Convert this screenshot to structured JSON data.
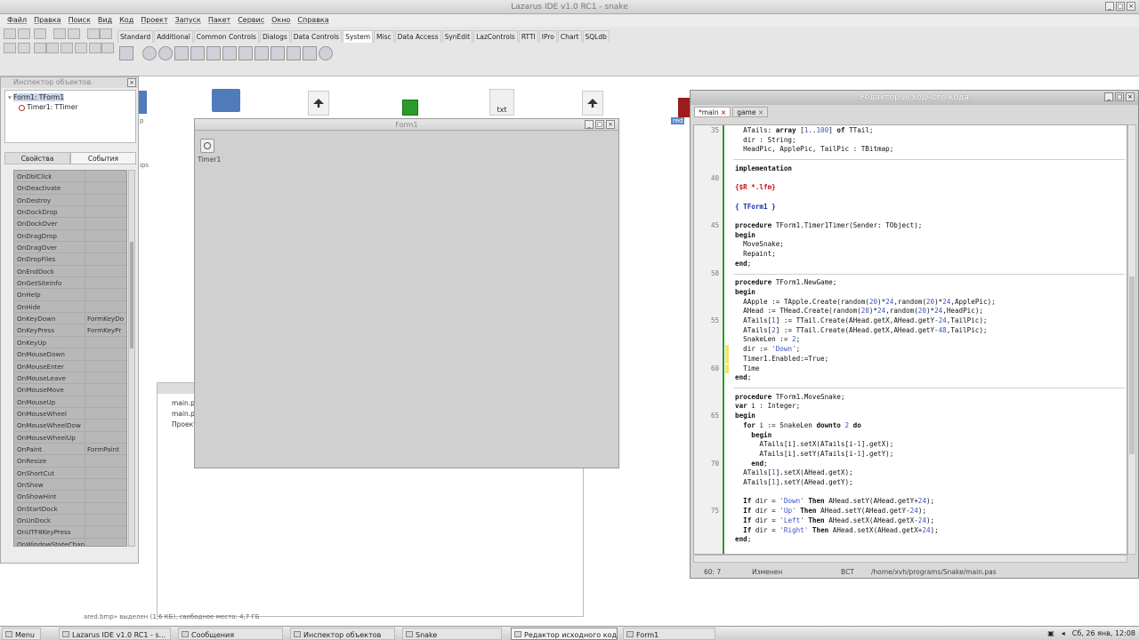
{
  "ide": {
    "title": "Lazarus IDE v1.0 RC1 - snake",
    "menu": [
      "Файл",
      "Правка",
      "Поиск",
      "Вид",
      "Код",
      "Проект",
      "Запуск",
      "Пакет",
      "Сервис",
      "Окно",
      "Справка"
    ],
    "palette_tabs": [
      "Standard",
      "Additional",
      "Common Controls",
      "Dialogs",
      "Data Controls",
      "System",
      "Misc",
      "Data Access",
      "SynEdit",
      "LazControls",
      "RTTI",
      "IPro",
      "Chart",
      "SQLdb"
    ],
    "active_palette_tab": "System"
  },
  "desktop_icons": {
    "txt_label": "txt",
    "side_label_1": "p",
    "side_label_2": "ips",
    "red_label": "red"
  },
  "inspector": {
    "title": "Инспектор объектов",
    "tree": [
      {
        "label": "Form1: TForm1"
      },
      {
        "label": "Timer1: TTimer"
      }
    ],
    "tabs": [
      "Свойства",
      "События"
    ],
    "active_tab": "События",
    "events": [
      {
        "name": "OnDblClick",
        "value": ""
      },
      {
        "name": "OnDeactivate",
        "value": ""
      },
      {
        "name": "OnDestroy",
        "value": ""
      },
      {
        "name": "OnDockDrop",
        "value": ""
      },
      {
        "name": "OnDockOver",
        "value": ""
      },
      {
        "name": "OnDragDrop",
        "value": ""
      },
      {
        "name": "OnDragOver",
        "value": ""
      },
      {
        "name": "OnDropFiles",
        "value": ""
      },
      {
        "name": "OnEndDock",
        "value": ""
      },
      {
        "name": "OnGetSiteInfo",
        "value": ""
      },
      {
        "name": "OnHelp",
        "value": ""
      },
      {
        "name": "OnHide",
        "value": ""
      },
      {
        "name": "OnKeyDown",
        "value": "FormKeyDo"
      },
      {
        "name": "OnKeyPress",
        "value": "FormKeyPr"
      },
      {
        "name": "OnKeyUp",
        "value": ""
      },
      {
        "name": "OnMouseDown",
        "value": ""
      },
      {
        "name": "OnMouseEnter",
        "value": ""
      },
      {
        "name": "OnMouseLeave",
        "value": ""
      },
      {
        "name": "OnMouseMove",
        "value": ""
      },
      {
        "name": "OnMouseUp",
        "value": ""
      },
      {
        "name": "OnMouseWheel",
        "value": ""
      },
      {
        "name": "OnMouseWheelDow",
        "value": ""
      },
      {
        "name": "OnMouseWheelUp",
        "value": ""
      },
      {
        "name": "OnPaint",
        "value": "FormPaint"
      },
      {
        "name": "OnResize",
        "value": ""
      },
      {
        "name": "OnShortCut",
        "value": ""
      },
      {
        "name": "OnShow",
        "value": ""
      },
      {
        "name": "OnShowHint",
        "value": ""
      },
      {
        "name": "OnStartDock",
        "value": ""
      },
      {
        "name": "OnUnDock",
        "value": ""
      },
      {
        "name": "OnUTF8KeyPress",
        "value": ""
      },
      {
        "name": "OnWindowStateChan",
        "value": ""
      }
    ]
  },
  "messages": {
    "lines": [
      "main.p",
      "main.p",
      "Проект"
    ]
  },
  "form1": {
    "title": "Form1",
    "timer_label": "Timer1"
  },
  "editor": {
    "title": "Редактор исходного кода",
    "tabs": [
      "*main",
      "game"
    ],
    "active_tab": "*main",
    "line_numbers": [
      {
        "n": "35",
        "row": 0
      },
      {
        "n": "40",
        "row": 5
      },
      {
        "n": "45",
        "row": 10
      },
      {
        "n": "50",
        "row": 15
      },
      {
        "n": "55",
        "row": 20
      },
      {
        "n": "60",
        "row": 25
      },
      {
        "n": "65",
        "row": 30
      },
      {
        "n": "70",
        "row": 35
      },
      {
        "n": "75",
        "row": 40
      }
    ],
    "code_lines": [
      "  ATails: array [1..100] of TTail;",
      "  dir : String;",
      "  HeadPic, ApplePic, TailPic : TBitmap;",
      "",
      "implementation",
      "",
      "{$R *.lfm}",
      "",
      "{ TForm1 }",
      "",
      "procedure TForm1.Timer1Timer(Sender: TObject);",
      "begin",
      "  MoveSnake;",
      "  Repaint;",
      "end;",
      "",
      "procedure TForm1.NewGame;",
      "begin",
      "  AApple := TApple.Create(random(20)*24,random(20)*24,ApplePic);",
      "  AHead := THead.Create(random(20)*24,random(20)*24,HeadPic);",
      "  ATails[1] := TTail.Create(AHead.getX,AHead.getY-24,TailPic);",
      "  ATails[2] := TTail.Create(AHead.getX,AHead.getY-48,TailPic);",
      "  SnakeLen := 2;",
      "  dir := 'Down';",
      "  Timer1.Enabled:=True;",
      "  Time",
      "end;",
      "",
      "procedure TForm1.MoveSnake;",
      "var i : Integer;",
      "begin",
      "  for i := SnakeLen downto 2 do",
      "    begin",
      "      ATails[i].setX(ATails[i-1].getX);",
      "      ATails[i].setY(ATails[i-1].getY);",
      "    end;",
      "  ATails[1].setX(AHead.getX);",
      "  ATails[1].setY(AHead.getY);",
      "",
      "  If dir = 'Down' Then AHead.setY(AHead.getY+24);",
      "  If dir = 'Up' Then AHead.setY(AHead.getY-24);",
      "  If dir = 'Left' Then AHead.setX(AHead.getX-24);",
      "  If dir = 'Right' Then AHead.setX(AHead.getX+24);",
      "end;"
    ],
    "status": {
      "position": "60: 7",
      "modified": "Изменен",
      "mode": "ВСТ",
      "path": "/home/xvh/programs/Snake/main.pas"
    }
  },
  "bg_status_text": "ared.bmp» выделен (1,6 КБ), свободное место: 4,7 ГБ",
  "taskbar": {
    "menu_label": "Menu",
    "items": [
      {
        "label": "Lazarus IDE v1.0 RC1 - s..."
      },
      {
        "label": "Сообщения"
      },
      {
        "label": "Инспектор объектов"
      },
      {
        "label": "Snake"
      },
      {
        "label": "Редактор исходного кода"
      },
      {
        "label": "Form1"
      }
    ],
    "active_item": "Редактор исходного кода",
    "clock": "Сб, 26 янв, 12:08"
  }
}
